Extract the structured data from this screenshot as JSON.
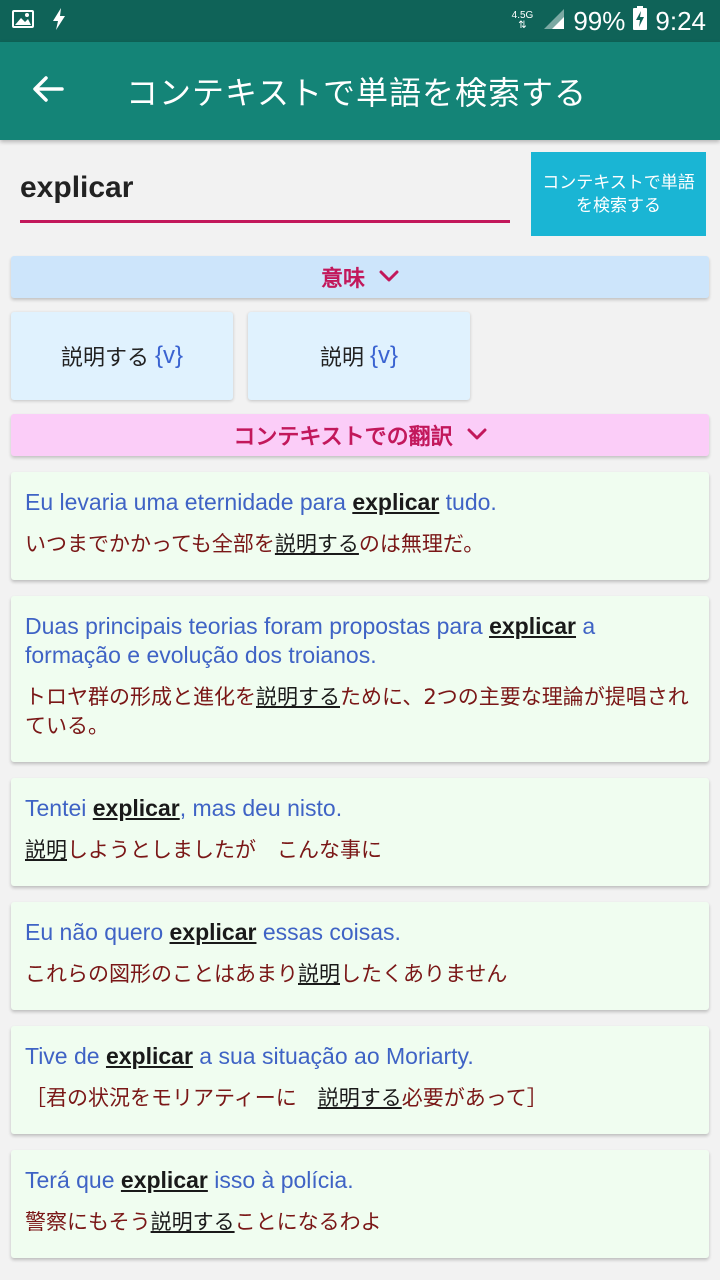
{
  "status_bar": {
    "network": "4.5G",
    "battery": "99%",
    "time": "9:24",
    "icons": [
      "image-icon",
      "flash-icon",
      "signal-icon",
      "battery-charging-icon"
    ]
  },
  "app_bar": {
    "title": "コンテキストで単語を検索する",
    "back_icon": "arrow-left-icon"
  },
  "search": {
    "value": "explicar",
    "button_label": "コンテキストで単語を検索する"
  },
  "meaning_section": {
    "label": "意味",
    "toggle_icon": "chevron-down-icon",
    "chips": [
      {
        "word": "説明する",
        "pos": "{v}"
      },
      {
        "word": "説明",
        "pos": "{v}"
      }
    ]
  },
  "context_section": {
    "label": "コンテキストでの翻訳",
    "toggle_icon": "chevron-down-icon"
  },
  "examples": [
    {
      "src_before": "Eu levaria uma eternidade para ",
      "src_key": "explicar",
      "src_after": " tudo.",
      "tgt_before": "いつまでかかっても全部を",
      "tgt_key": "説明する",
      "tgt_after": "のは無理だ。"
    },
    {
      "src_before": "Duas principais teorias foram propostas para ",
      "src_key": "explicar",
      "src_after": " a formação e evolução dos troianos.",
      "tgt_before": "トロヤ群の形成と進化を",
      "tgt_key": "説明する",
      "tgt_after": "ために、2つの主要な理論が提唱されている。"
    },
    {
      "src_before": "Tentei ",
      "src_key": "explicar",
      "src_after": ", mas deu nisto.",
      "tgt_before": "",
      "tgt_key": "説明",
      "tgt_after": "しようとしましたが　こんな事に"
    },
    {
      "src_before": "Eu não quero ",
      "src_key": "explicar",
      "src_after": " essas coisas.",
      "tgt_before": "これらの図形のことはあまり",
      "tgt_key": "説明",
      "tgt_after": "したくありません"
    },
    {
      "src_before": "Tive de ",
      "src_key": "explicar",
      "src_after": " a sua situação ao Moriarty.",
      "tgt_before": "［君の状況をモリアティーに　",
      "tgt_key": "説明する",
      "tgt_after": "必要があって］"
    },
    {
      "src_before": "Terá que ",
      "src_key": "explicar",
      "src_after": " isso à polícia.",
      "tgt_before": "警察にもそう",
      "tgt_key": "説明する",
      "tgt_after": "ことになるわよ"
    }
  ]
}
